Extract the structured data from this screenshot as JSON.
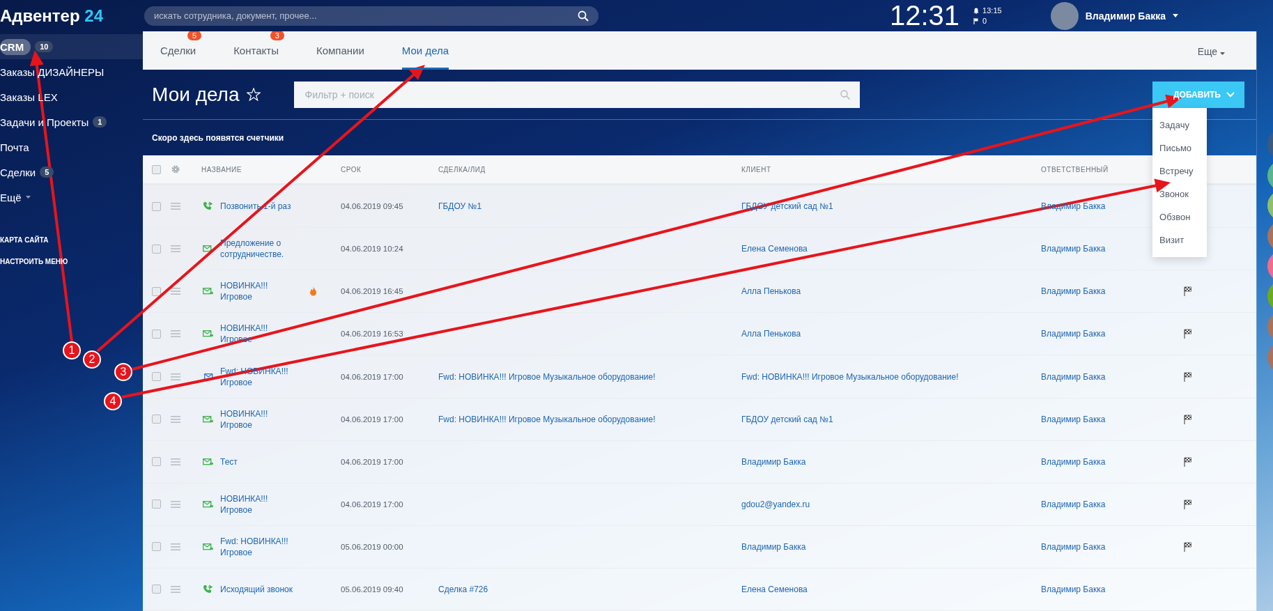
{
  "header": {
    "logo": "Адвентер",
    "logo_suffix": "24",
    "search": {
      "placeholder": "искать сотрудника, документ, прочее..."
    },
    "clock": "12:31",
    "notifications": "13:15",
    "flags": "0",
    "user": {
      "name": "Владимир Бакка"
    }
  },
  "sidebar": {
    "items": [
      {
        "label": "CRM",
        "badge": "10",
        "selected": true
      },
      {
        "label": "Заказы ДИЗАЙНЕРЫ",
        "selected": false
      },
      {
        "label": "Заказы LEX",
        "selected": false
      },
      {
        "label": "Задачи и Проекты",
        "badge": "1",
        "selected": false
      },
      {
        "label": "Почта",
        "selected": false
      },
      {
        "label": "Сделки",
        "badge": "5",
        "selected": false
      },
      {
        "label": "Ещё",
        "caret": true,
        "selected": false
      }
    ],
    "links": [
      "КАРТА САЙТА",
      "НАСТРОИТЬ МЕНЮ"
    ]
  },
  "tabs": [
    {
      "label": "Сделки",
      "badge": "5",
      "selected": false
    },
    {
      "label": "Контакты",
      "badge": "3",
      "selected": false
    },
    {
      "label": "Компании",
      "selected": false
    },
    {
      "label": "Мои дела",
      "selected": true
    }
  ],
  "more_tab": "Еще",
  "page": {
    "title": "Мои дела",
    "filter": {
      "placeholder": "Фильтр + поиск"
    },
    "add_button": "ДОБАВИТЬ",
    "add_menu": [
      "Задачу",
      "Письмо",
      "Встречу",
      "Звонок",
      "Обзвон",
      "Визит"
    ],
    "counters_note": "Скоро здесь появятся счетчики"
  },
  "table": {
    "select_all": {
      "checked": false
    },
    "columns": [
      "НАЗВАНИЕ",
      "СРОК",
      "СДЕЛКА/ЛИД",
      "КЛИЕНТ",
      "ОТВЕТСТВЕННЫЙ"
    ],
    "rows": [
      {
        "kind": "call",
        "checked": false,
        "title": "Позвонить 1-й раз",
        "hot": false,
        "due": "04.06.2019 09:45",
        "deal": "ГБДОУ №1",
        "client": "ГБДОУ детский сад №1",
        "owner": "Владимир Бакка",
        "flag": false
      },
      {
        "kind": "email-out",
        "checked": false,
        "title": "Предложение о сотрудничестве.",
        "hot": false,
        "due": "04.06.2019 10:24",
        "client": "Елена Семенова",
        "owner": "Владимир Бакка",
        "flag": false
      },
      {
        "kind": "email-out",
        "checked": false,
        "title": "НОВИНКА!!! Игровое",
        "hot": true,
        "due": "04.06.2019 16:45",
        "client": "Алла Пенькова",
        "owner": "Владимир Бакка",
        "flag": true
      },
      {
        "kind": "email-out",
        "checked": false,
        "title": "НОВИНКА!!! Игровое",
        "hot": false,
        "due": "04.06.2019 16:53",
        "client": "Алла Пенькова",
        "owner": "Владимир Бакка",
        "flag": true
      },
      {
        "kind": "email-in",
        "checked": false,
        "title": "Fwd: НОВИНКА!!! Игровое",
        "hot": false,
        "due": "04.06.2019 17:00",
        "deal": "Fwd: НОВИНКА!!! Игровое Музыкальное оборудование!",
        "client": "Fwd: НОВИНКА!!! Игровое Музыкальное оборудование!",
        "owner": "Владимир Бакка",
        "flag": true
      },
      {
        "kind": "email-out",
        "checked": false,
        "title": "НОВИНКА!!! Игровое",
        "hot": false,
        "due": "04.06.2019 17:00",
        "deal": "Fwd: НОВИНКА!!! Игровое Музыкальное оборудование!",
        "client": "ГБДОУ детский сад №1",
        "owner": "Владимир Бакка",
        "flag": true
      },
      {
        "kind": "email-out",
        "checked": false,
        "title": "Тест",
        "hot": false,
        "due": "04.06.2019 17:00",
        "client": "Владимир Бакка",
        "owner": "Владимир Бакка",
        "flag": true
      },
      {
        "kind": "email-out",
        "checked": false,
        "title": "НОВИНКА!!! Игровое",
        "hot": false,
        "due": "04.06.2019 17:00",
        "client": "gdou2@yandex.ru",
        "owner": "Владимир Бакка",
        "flag": true
      },
      {
        "kind": "email-out",
        "checked": false,
        "title": "Fwd: НОВИНКА!!! Игровое",
        "hot": false,
        "due": "05.06.2019 00:00",
        "client": "Владимир Бакка",
        "owner": "Владимир Бакка",
        "flag": true
      },
      {
        "kind": "call",
        "checked": false,
        "title": "Исходящий звонок",
        "hot": false,
        "due": "05.06.2019 09:40",
        "deal": "Сделка #726",
        "client": "Елена Семенова",
        "owner": "Владимир Бакка",
        "flag": false
      }
    ]
  },
  "avatars": [
    {
      "color": "#3b5a80"
    },
    {
      "color": "#5ab58a"
    },
    {
      "color": "#8fbf6a"
    },
    {
      "color": "#a8735c"
    },
    {
      "color": "#f06c8c"
    },
    {
      "color": "#6aac1e"
    },
    {
      "color": "#a8735c"
    },
    {
      "color": "#a8735c"
    }
  ],
  "annotations": [
    {
      "label": "1"
    },
    {
      "label": "2"
    },
    {
      "label": "3"
    },
    {
      "label": "4"
    }
  ]
}
